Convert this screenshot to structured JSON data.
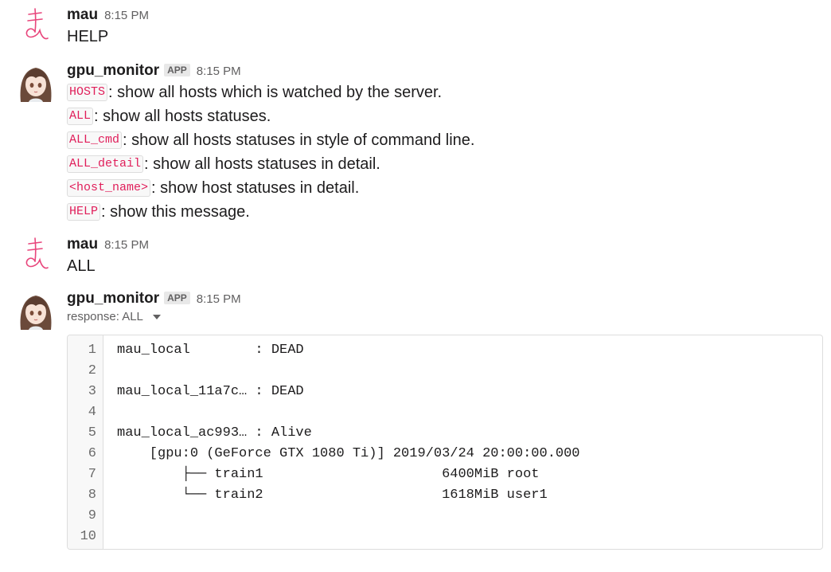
{
  "messages": [
    {
      "author": "mau",
      "time": "8:15 PM",
      "avatar_icon": "hiragana-ma-avatar-icon",
      "text": "HELP"
    },
    {
      "author": "gpu_monitor",
      "badge": "APP",
      "time": "8:15 PM",
      "avatar_icon": "anime-girl-avatar-icon",
      "lines": [
        {
          "code": "HOSTS",
          "text": ": show all hosts which is watched by the server."
        },
        {
          "code": "ALL",
          "text": ": show all hosts statuses."
        },
        {
          "code": "ALL_cmd",
          "text": ": show all hosts statuses in style of command line."
        },
        {
          "code": "ALL_detail",
          "text": ": show all hosts statuses in detail."
        },
        {
          "code": "<host_name>",
          "text": ": show host statuses in detail."
        },
        {
          "code": "HELP",
          "text": ": show this message."
        }
      ]
    },
    {
      "author": "mau",
      "time": "8:15 PM",
      "avatar_icon": "hiragana-ma-avatar-icon",
      "text": "ALL"
    },
    {
      "author": "gpu_monitor",
      "badge": "APP",
      "time": "8:15 PM",
      "avatar_icon": "anime-girl-avatar-icon",
      "snippet_title": "response: ALL",
      "snippet": {
        "line_numbers": [
          "1",
          "2",
          "3",
          "4",
          "5",
          "6",
          "7",
          "8",
          "9",
          "10"
        ],
        "lines": [
          "mau_local        : DEAD",
          "",
          "mau_local_11a7c… : DEAD",
          "",
          "mau_local_ac993… : Alive",
          "    [gpu:0 (GeForce GTX 1080 Ti)] 2019/03/24 20:00:00.000",
          "        ├── train1                      6400MiB root",
          "        └── train2                      1618MiB user1",
          "",
          ""
        ]
      }
    }
  ],
  "colors": {
    "inline_code_text": "#e01e5a",
    "inline_code_bg": "#f8f8f8",
    "timestamp": "#616061",
    "avatar_ma_stroke": "#e8467c"
  }
}
